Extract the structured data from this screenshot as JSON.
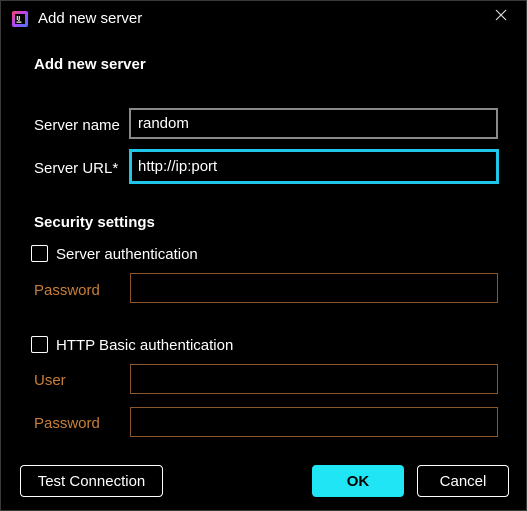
{
  "window": {
    "title": "Add new server"
  },
  "form": {
    "heading": "Add new server",
    "server_name_label": "Server name",
    "server_name_value": "random",
    "server_url_label": "Server URL*",
    "server_url_value": "http://ip:port"
  },
  "security": {
    "heading": "Security settings",
    "server_auth": {
      "label": "Server authentication",
      "checked": false,
      "password_label": "Password",
      "password_value": ""
    },
    "http_basic_auth": {
      "label": "HTTP Basic authentication",
      "checked": false,
      "user_label": "User",
      "user_value": "",
      "password_label": "Password",
      "password_value": ""
    }
  },
  "buttons": {
    "test_connection": "Test Connection",
    "ok": "OK",
    "cancel": "Cancel"
  },
  "colors": {
    "background": "#000000",
    "focus_border": "#1fc6e8",
    "primary_button": "#1fe5f5",
    "disabled_label": "#c77f3a",
    "disabled_border": "#8a5a2e"
  },
  "icons": {
    "app": "app-logo-icon",
    "close": "close-icon"
  }
}
